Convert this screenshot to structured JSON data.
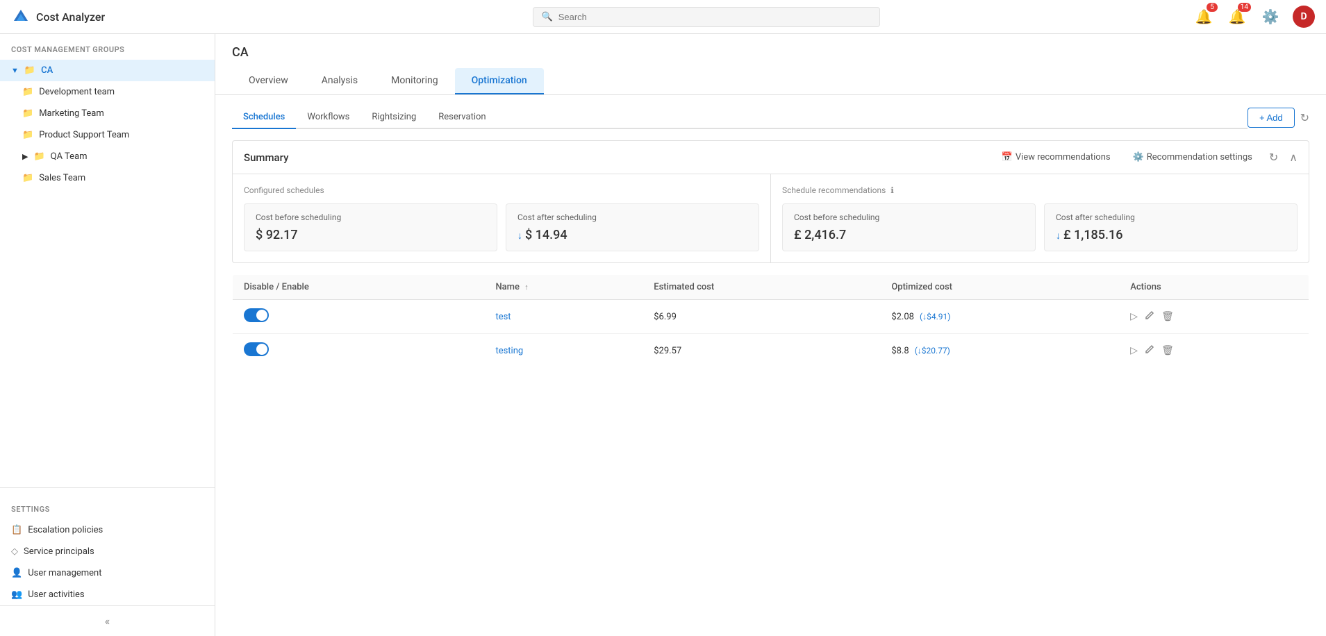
{
  "app": {
    "title": "Cost Analyzer",
    "logo_text": "CA"
  },
  "header": {
    "search_placeholder": "Search",
    "notifications_badge": "5",
    "alerts_badge": "14",
    "avatar_letter": "D"
  },
  "sidebar": {
    "section_label": "COST MANAGEMENT GROUPS",
    "items": [
      {
        "id": "ca",
        "label": "CA",
        "indent": 0,
        "has_chevron": true,
        "active": true
      },
      {
        "id": "development-team",
        "label": "Development team",
        "indent": 1
      },
      {
        "id": "marketing-team",
        "label": "Marketing Team",
        "indent": 1
      },
      {
        "id": "product-support-team",
        "label": "Product Support Team",
        "indent": 1
      },
      {
        "id": "qa-team",
        "label": "QA Team",
        "indent": 1,
        "has_chevron": true,
        "collapsed": true
      },
      {
        "id": "sales-team",
        "label": "Sales Team",
        "indent": 1
      }
    ],
    "settings_label": "SETTINGS",
    "settings_items": [
      {
        "id": "escalation-policies",
        "label": "Escalation policies",
        "icon": "escalation"
      },
      {
        "id": "service-principals",
        "label": "Service principals",
        "icon": "service"
      },
      {
        "id": "user-management",
        "label": "User management",
        "icon": "user-mgmt"
      },
      {
        "id": "user-activities",
        "label": "User activities",
        "icon": "user-act"
      }
    ],
    "collapse_tooltip": "Collapse"
  },
  "content": {
    "page_title": "CA",
    "main_tabs": [
      {
        "id": "overview",
        "label": "Overview"
      },
      {
        "id": "analysis",
        "label": "Analysis"
      },
      {
        "id": "monitoring",
        "label": "Monitoring"
      },
      {
        "id": "optimization",
        "label": "Optimization",
        "active": true
      }
    ],
    "sub_tabs": [
      {
        "id": "schedules",
        "label": "Schedules",
        "active": true
      },
      {
        "id": "workflows",
        "label": "Workflows"
      },
      {
        "id": "rightsizing",
        "label": "Rightsizing"
      },
      {
        "id": "reservation",
        "label": "Reservation"
      }
    ],
    "add_button": "+ Add",
    "summary": {
      "title": "Summary",
      "view_recommendations": "View recommendations",
      "recommendation_settings": "Recommendation settings",
      "configured_section_label": "Configured schedules",
      "recommendations_section_label": "Schedule recommendations",
      "cost_before_scheduling_label": "Cost before scheduling",
      "cost_after_scheduling_label": "Cost after scheduling",
      "cost_before_scheduling_value": "$ 92.17",
      "cost_after_scheduling_value": "↓ $ 14.94",
      "rec_cost_before_label": "Cost before scheduling",
      "rec_cost_after_label": "Cost after scheduling",
      "rec_cost_before_value": "£ 2,416.7",
      "rec_cost_after_value": "↓ £ 1,185.16"
    },
    "table": {
      "columns": [
        {
          "id": "disable-enable",
          "label": "Disable / Enable"
        },
        {
          "id": "name",
          "label": "Name",
          "sort": true
        },
        {
          "id": "estimated-cost",
          "label": "Estimated cost"
        },
        {
          "id": "optimized-cost",
          "label": "Optimized cost"
        },
        {
          "id": "actions",
          "label": "Actions"
        }
      ],
      "rows": [
        {
          "enabled": true,
          "name": "test",
          "estimated_cost": "$6.99",
          "optimized_cost": "$2.08",
          "savings": "(↓$4.91)"
        },
        {
          "enabled": true,
          "name": "testing",
          "estimated_cost": "$29.57",
          "optimized_cost": "$8.8",
          "savings": "(↓$20.77)"
        }
      ]
    }
  }
}
